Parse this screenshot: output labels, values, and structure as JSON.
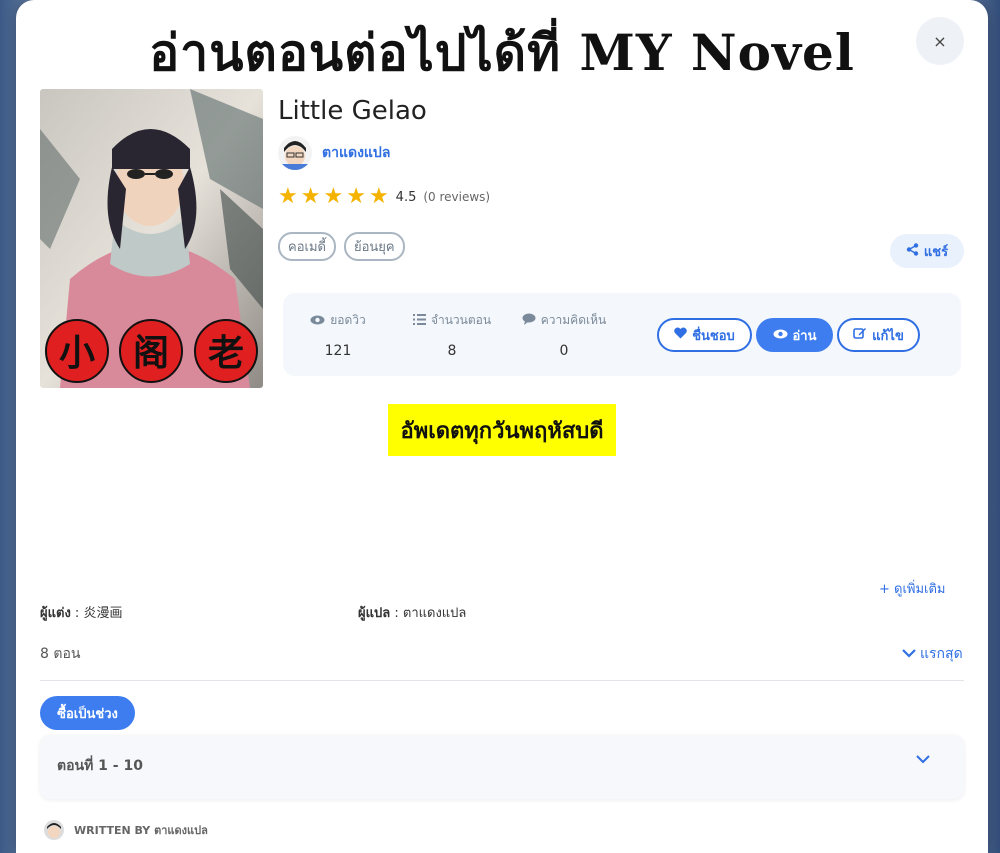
{
  "banner": {
    "text": "อ่านตอนต่อไปได้ที่ MY Novel"
  },
  "modal": {
    "close_label": "×"
  },
  "novel": {
    "title": "Little Gelao",
    "author_name": "ตาแดงแปล",
    "rating_score": "4.5",
    "rating_reviews": "(0 reviews)",
    "rating_value": 4.5,
    "tags": [
      "คอเมดี้",
      "ย้อนยุค"
    ],
    "cover_text": [
      "小",
      "阁",
      "老"
    ]
  },
  "share": {
    "label": "แชร์"
  },
  "stats": [
    {
      "label": "ยอดวิว",
      "value": "121",
      "icon": "eye-icon"
    },
    {
      "label": "จำนวนตอน",
      "value": "8",
      "icon": "list-icon"
    },
    {
      "label": "ความคิดเห็น",
      "value": "0",
      "icon": "comment-icon"
    }
  ],
  "actions": {
    "like": "ชื่นชอบ",
    "read": "อ่าน",
    "edit": "แก้ไข"
  },
  "announcement": "อัพเดตทุกวันพฤหัสบดี",
  "see_more": "+ ดูเพิ่มเติม",
  "credits": {
    "writer_label": "ผู้แต่ง",
    "writer": "炎漫画",
    "translator_label": "ผู้แปล",
    "translator": "ตาแดงแปล"
  },
  "episodes": {
    "count_label": "8 ตอน",
    "sort_label": "แรกสุด",
    "range_button": "ซื้อเป็นช่วง",
    "range_label": "ตอนที่ 1 - 10"
  },
  "footer": {
    "written_by": "WRITTEN BY ตาแดงแปล"
  },
  "colors": {
    "accent": "#3d7df0",
    "star": "#f5b301",
    "highlight": "#ffff00"
  }
}
